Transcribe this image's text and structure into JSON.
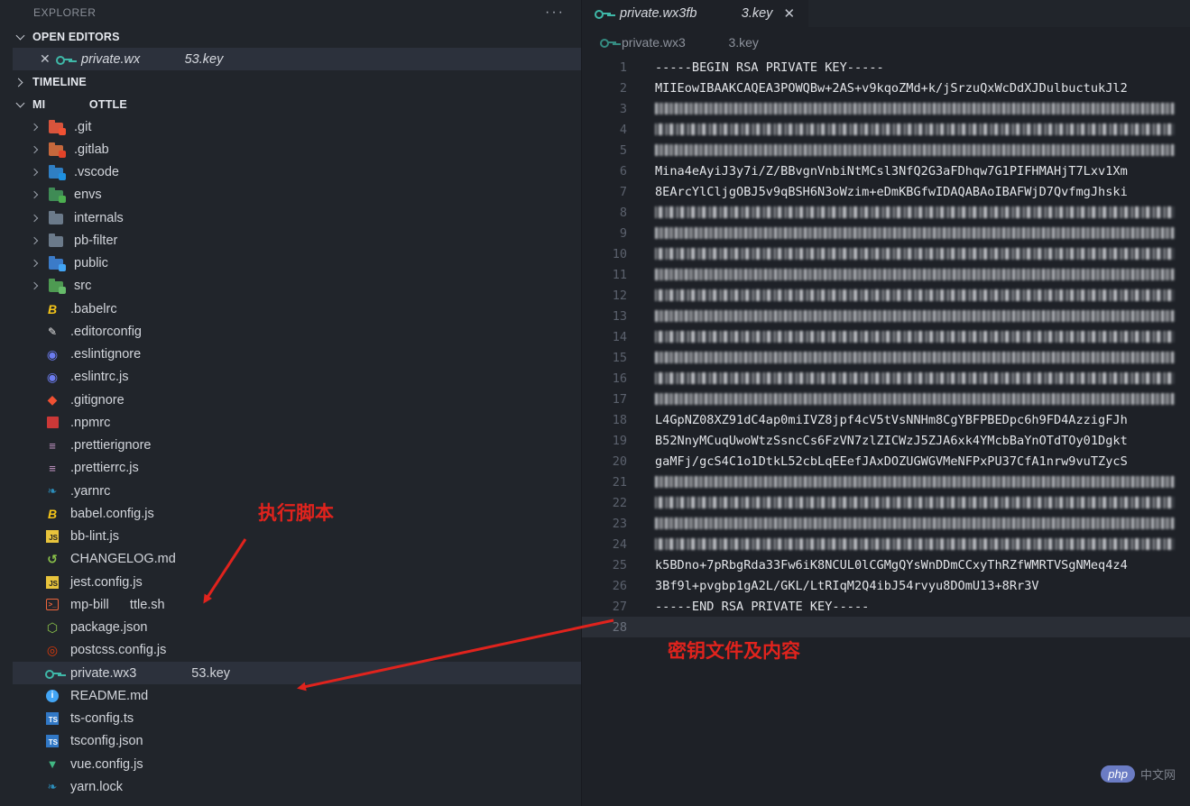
{
  "sidebar": {
    "header": "EXPLORER",
    "more": "···",
    "sections": {
      "open_editors": "OPEN EDITORS",
      "timeline": "TIMELINE",
      "project": "MI                  OTTLE"
    },
    "open_editor_file": "private.wx                 53.key",
    "folders": [
      ".git",
      ".gitlab",
      ".vscode",
      "envs",
      "internals",
      "pb-filter",
      "public",
      "src"
    ],
    "files": [
      ".babelrc",
      ".editorconfig",
      ".eslintignore",
      ".eslintrc.js",
      ".gitignore",
      ".npmrc",
      ".prettierignore",
      ".prettierrc.js",
      ".yarnrc",
      "babel.config.js",
      "bb-lint.js",
      "CHANGELOG.md",
      "jest.config.js",
      "mp-bill        ttle.sh",
      "package.json",
      "postcss.config.js",
      "private.wx3                     53.key",
      "README.md",
      "ts-config.ts",
      "tsconfig.json",
      "vue.config.js",
      "yarn.lock"
    ]
  },
  "editor": {
    "tab_label": "private.wx3fb                 3.key",
    "breadcrumb": "private.wx3                 3.key",
    "lines": [
      "-----BEGIN RSA PRIVATE KEY-----",
      "MIIEowIBAAKCAQEA3POWQBw+2AS+v9kqoZMd+k/jSrzuQxWcDdXJDulbuctukJl2",
      "",
      "",
      "",
      "Mina4eAyiJ3y7i/Z/BBvgnVnbiNtMCsl3NfQ2G3aFDhqw7G1PIFHMAHjT7Lxv1Xm",
      "8EArcYlCljgOBJ5v9qBSH6N3oWzim+eDmKBGfwIDAQABAoIBAFWjD7QvfmgJhski",
      "",
      "",
      "",
      "",
      "",
      "",
      "",
      "",
      "",
      "",
      "L4GpNZ08XZ91dC4ap0miIVZ8jpf4cV5tVsNNHm8CgYBFPBEDpc6h9FD4AzzigFJh",
      "B52NnyMCuqUwoWtzSsncCs6FzVN7zlZICWzJ5ZJA6xk4YMcbBaYnOTdTOy01Dgkt",
      "gaMFj/gcS4C1o1DtkL52cbLqEEefJAxDOZUGWGVMeNFPxPU37CfA1nrw9vuTZycS",
      "",
      "",
      "",
      "",
      "k5BDno+7pRbgRda33Fw6iK8NCUL0lCGMgQYsWnDDmCCxyThRZfWMRTVSgNMeq4z4",
      "3Bf9l+pvgbp1gA2L/GKL/LtRIqM2Q4ibJ54rvyu8DOmU13+8Rr3V",
      "-----END RSA PRIVATE KEY-----",
      ""
    ]
  },
  "annotations": {
    "script_label": "执行脚本",
    "key_label": "密钥文件及内容"
  },
  "watermark": {
    "badge": "php",
    "text": "中文网"
  },
  "colors": {
    "annotation_red": "#e0231d",
    "key_icon": "#3fb8a8",
    "sidebar_bg": "#21252b",
    "editor_bg": "#1e2127"
  }
}
